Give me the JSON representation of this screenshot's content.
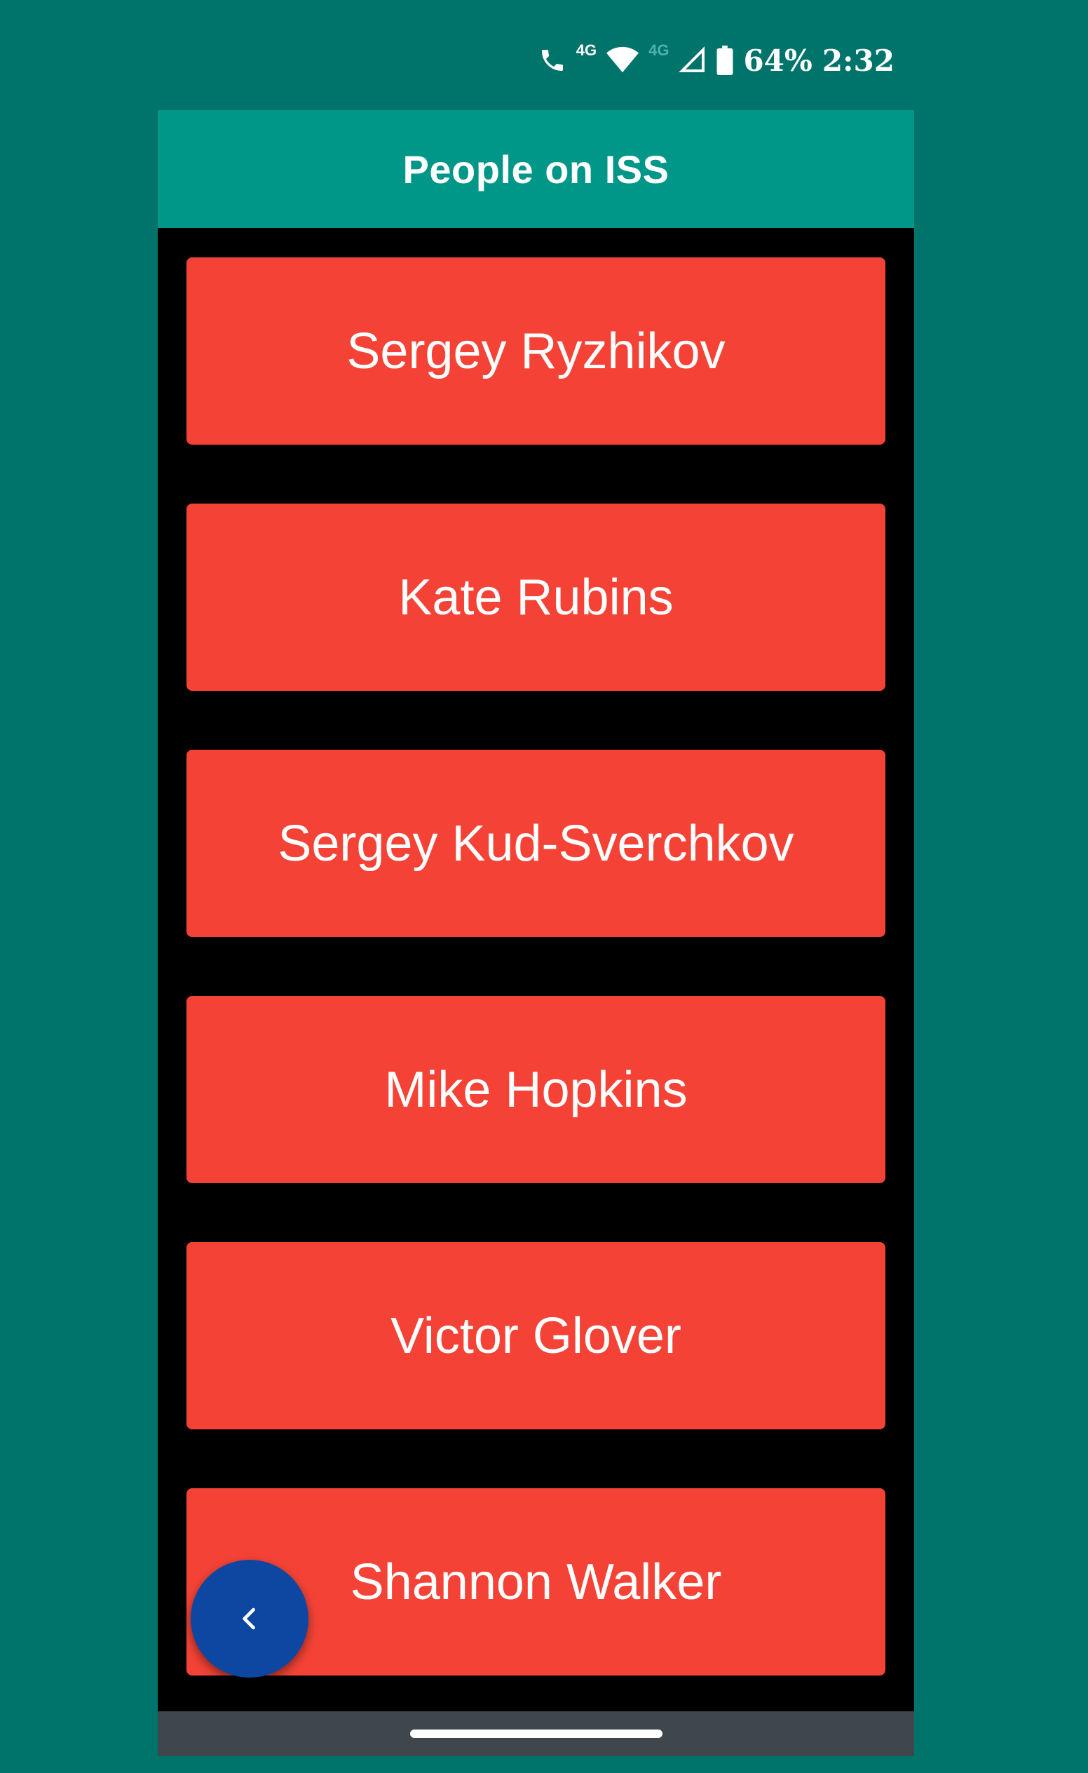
{
  "status_bar": {
    "network_label_1": "4G",
    "network_label_2": "4G",
    "battery": "64%",
    "time": "2:32",
    "icons": [
      "call-icon",
      "wifi-icon",
      "signal-icon",
      "battery-icon"
    ]
  },
  "app_bar": {
    "title": "People on ISS",
    "color": "#009688"
  },
  "people": [
    {
      "name": "Sergey Ryzhikov"
    },
    {
      "name": "Kate Rubins"
    },
    {
      "name": "Sergey Kud-Sverchkov"
    },
    {
      "name": "Mike Hopkins"
    },
    {
      "name": "Victor Glover"
    },
    {
      "name": "Shannon Walker"
    }
  ],
  "colors": {
    "background": "#00736A",
    "card": "#F44336",
    "fab": "#0D47A1"
  },
  "fab": {
    "icon": "chevron-left-icon"
  }
}
